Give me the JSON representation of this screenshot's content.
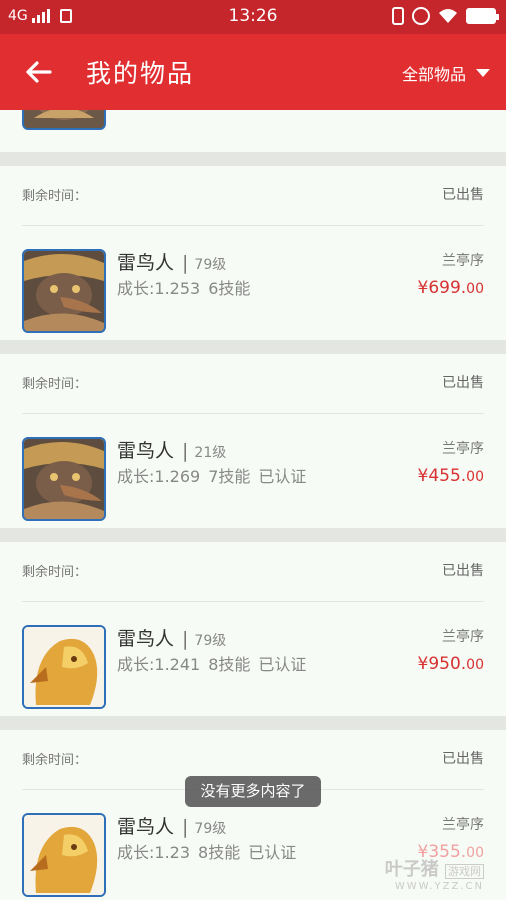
{
  "statusbar": {
    "network": "4G",
    "time": "13:26"
  },
  "header": {
    "title": "我的物品",
    "filter": "全部物品"
  },
  "colors": {
    "header_bg": "#e12f31",
    "statusbar_bg": "#c4262b",
    "price": "#d83132",
    "thumb_border": "#2e6fb8"
  },
  "list": {
    "items": [
      {
        "remain_label": "剩余时间：",
        "status": "已出售",
        "name": "雷鸟人",
        "level": "79级",
        "growth": "成长:1.253",
        "skills": "6技能",
        "verified": "",
        "server": "兰亭序",
        "price_main": "¥699.",
        "price_cents": "00",
        "avatar": "thunderbird-warrior"
      },
      {
        "remain_label": "剩余时间：",
        "status": "已出售",
        "name": "雷鸟人",
        "level": "21级",
        "growth": "成长:1.269",
        "skills": "7技能",
        "verified": "已认证",
        "server": "兰亭序",
        "price_main": "¥455.",
        "price_cents": "00",
        "avatar": "thunderbird-warrior"
      },
      {
        "remain_label": "剩余时间：",
        "status": "已出售",
        "name": "雷鸟人",
        "level": "79级",
        "growth": "成长:1.241",
        "skills": "8技能",
        "verified": "已认证",
        "server": "兰亭序",
        "price_main": "¥950.",
        "price_cents": "00",
        "avatar": "golden-eagle"
      },
      {
        "remain_label": "剩余时间：",
        "status": "已出售",
        "name": "雷鸟人",
        "level": "79级",
        "growth": "成长:1.23",
        "skills": "8技能",
        "verified": "已认证",
        "server": "兰亭序",
        "price_main": "¥355.",
        "price_cents": "00",
        "avatar": "golden-eagle"
      }
    ]
  },
  "toast": "没有更多内容了",
  "watermark": {
    "main": "叶子猪",
    "tag": "游戏网",
    "url": "WWW.YZZ.CN"
  }
}
